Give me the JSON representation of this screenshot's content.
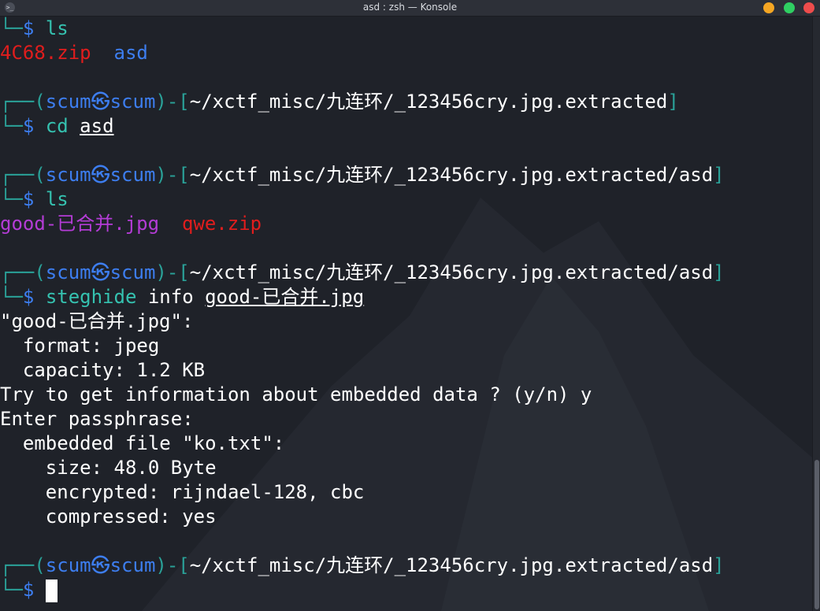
{
  "window": {
    "title": "asd : zsh — Konsole",
    "app_icon": ">_"
  },
  "prompt": {
    "top_rule": "┌──(",
    "bottom_rule": "└─",
    "user": "scum",
    "at_symbol": "㉿",
    "host": "scum",
    "mid": ")-[",
    "close": "]",
    "dollar": "$"
  },
  "lines": {
    "l1": {
      "cmd": "ls"
    },
    "l2": {
      "zip": "4C68.zip",
      "dir": "asd"
    },
    "p1": {
      "path": "~/xctf_misc/九连环/_123456cry.jpg.extracted"
    },
    "p1c": {
      "cmd": "cd",
      "arg": "asd"
    },
    "p2": {
      "path": "~/xctf_misc/九连环/_123456cry.jpg.extracted/asd"
    },
    "p2c": {
      "cmd": "ls"
    },
    "p2o": {
      "img": "good-已合并.jpg",
      "zip": "qwe.zip"
    },
    "p3": {
      "path": "~/xctf_misc/九连环/_123456cry.jpg.extracted/asd"
    },
    "p3c": {
      "cmd": "steghide",
      "word": "info",
      "arg": "good-已合并.jpg"
    },
    "o1": "\"good-已合并.jpg\":",
    "o2": "  format: jpeg",
    "o3": "  capacity: 1.2 KB",
    "o4": "Try to get information about embedded data ? (y/n) y",
    "o5": "Enter passphrase:",
    "o6": "  embedded file \"ko.txt\":",
    "o7": "    size: 48.0 Byte",
    "o8": "    encrypted: rijndael-128, cbc",
    "o9": "    compressed: yes",
    "p4": {
      "path": "~/xctf_misc/九连环/_123456cry.jpg.extracted/asd"
    }
  },
  "colors": {
    "prompt_blue": "#3d7ef0",
    "rule_teal": "#2aa198",
    "cmd_teal": "#35c2b0",
    "zip_red": "#e01d1d",
    "image_purple": "#b43cd6"
  }
}
